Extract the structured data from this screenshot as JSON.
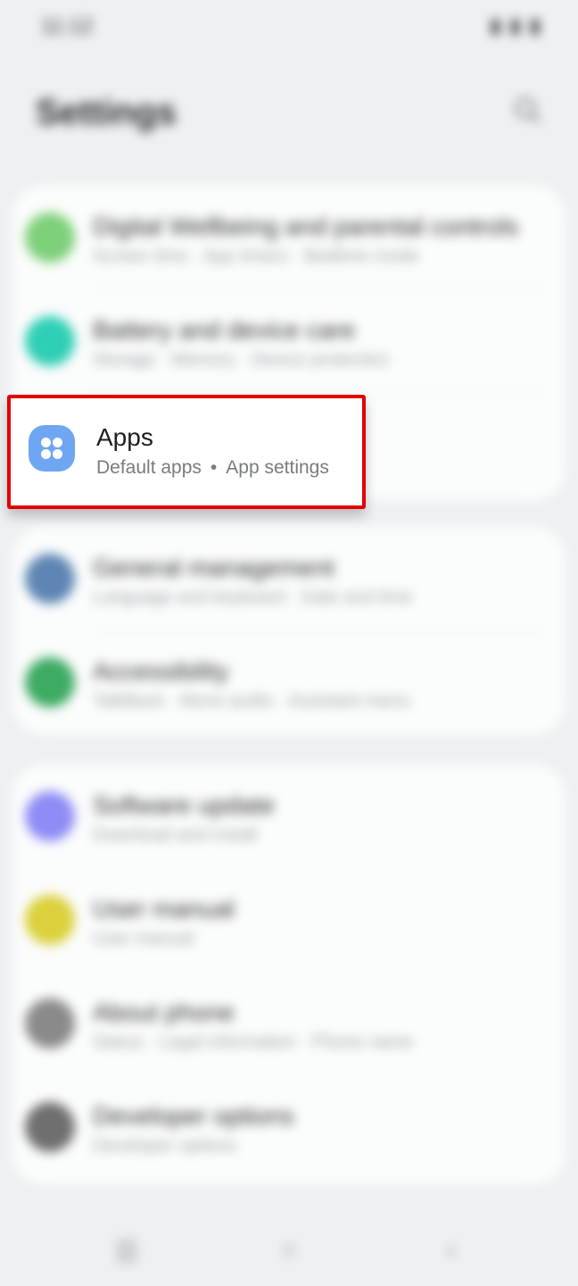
{
  "status_bar": {
    "time": "11:12",
    "icons": "▮ ▮ ▮"
  },
  "header": {
    "title": "Settings",
    "search_icon": "search-icon"
  },
  "groups": [
    {
      "items": [
        {
          "title": "Digital Wellbeing and parental controls",
          "subtitle": "Screen time  ·  App timers  ·  Bedtime mode",
          "icon_color": "#7ed07a"
        },
        {
          "title": "Battery and device care",
          "subtitle": "Storage  ·  Memory  ·  Device protection",
          "icon_color": "#2fcfb5"
        }
      ]
    },
    {
      "items": [
        {
          "title": "General management",
          "subtitle": "Language and keyboard  ·  Date and time",
          "icon_color": "#5d86b4"
        },
        {
          "title": "Accessibility",
          "subtitle": "TalkBack  ·  Mono audio  ·  Assistant menu",
          "icon_color": "#3dab62"
        }
      ]
    },
    {
      "items": [
        {
          "title": "Software update",
          "subtitle": "Download and install",
          "icon_color": "#8f8cf5"
        },
        {
          "title": "User manual",
          "subtitle": "User manual",
          "icon_color": "#dbd13c"
        },
        {
          "title": "About phone",
          "subtitle": "Status  ·  Legal information  ·  Phone name",
          "icon_color": "#8a8a8a"
        },
        {
          "title": "Developer options",
          "subtitle": "Developer options",
          "icon_color": "#6f6f6f"
        }
      ]
    }
  ],
  "highlighted_item": {
    "title": "Apps",
    "subtitle_parts": [
      "Default apps",
      "App settings"
    ],
    "separator": "•",
    "icon": "apps-grid-icon",
    "icon_color": "#6ea6f2",
    "highlight_color": "#e30000"
  },
  "nav_bar": {
    "recents_icon": "recents-icon",
    "home_icon": "home-icon",
    "back_icon": "back-icon",
    "recents_glyph": "|||",
    "home_glyph": "○",
    "back_glyph": "‹"
  }
}
